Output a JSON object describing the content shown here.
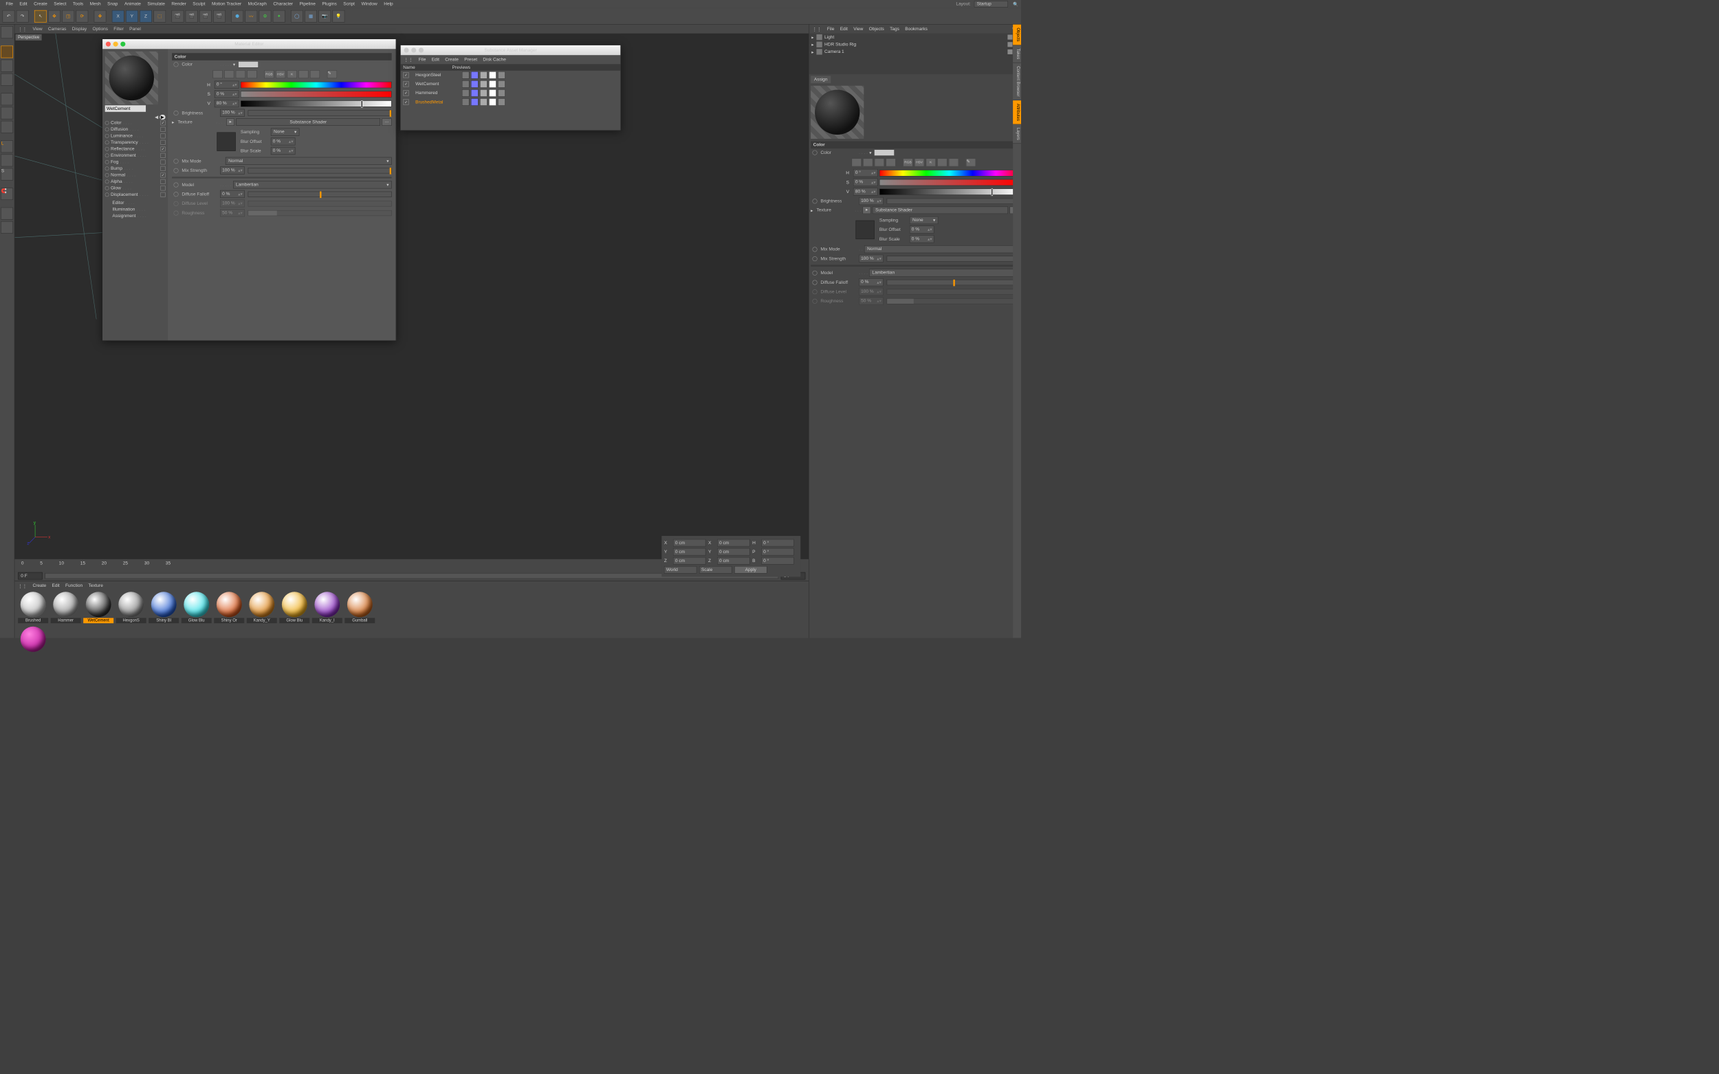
{
  "topmenu": [
    "File",
    "Edit",
    "Create",
    "Select",
    "Tools",
    "Mesh",
    "Snap",
    "Animate",
    "Simulate",
    "Render",
    "Sculpt",
    "Motion Tracker",
    "MoGraph",
    "Character",
    "Pipeline",
    "Plugins",
    "Script",
    "Window",
    "Help"
  ],
  "layout_label": "Layout:",
  "layout_value": "Startup",
  "viewmenu": [
    "View",
    "Cameras",
    "Display",
    "Options",
    "Filter",
    "Panel"
  ],
  "viewport_label": "Perspective",
  "objmenu": [
    "File",
    "Edit",
    "View",
    "Objects",
    "Tags",
    "Bookmarks"
  ],
  "objects": [
    "Light",
    "HDR Studio Rig",
    "Camera 1"
  ],
  "side_tabs": [
    "Objects",
    "Takes",
    "Content Browser",
    "Attributes",
    "Layers"
  ],
  "matmenu": [
    "Create",
    "Edit",
    "Function",
    "Texture"
  ],
  "materials": [
    {
      "name": "Brushed",
      "color": "#bbb"
    },
    {
      "name": "Hammer",
      "color": "#999"
    },
    {
      "name": "WetCement",
      "color": "#333",
      "sel": true
    },
    {
      "name": "HexgonS",
      "color": "#888"
    },
    {
      "name": "Shiny Bl",
      "color": "#2a60d0"
    },
    {
      "name": "Glow Blu",
      "color": "#3be0e8"
    },
    {
      "name": "Shiny Or",
      "color": "#d85a20"
    },
    {
      "name": "Kandy_Y",
      "color": "#e08a20"
    },
    {
      "name": "Glow Blu",
      "color": "#f0b020"
    },
    {
      "name": "Kandy_I",
      "color": "#8a30c0"
    },
    {
      "name": "Gumball",
      "color": "#d06a20"
    }
  ],
  "mat_extra": {
    "name": "",
    "color": "#ff30d0"
  },
  "frame": {
    "a": "0 F",
    "b": "0 F"
  },
  "ticks": [
    "0",
    "5",
    "10",
    "15",
    "20",
    "25",
    "30",
    "35"
  ],
  "coord": {
    "rows": [
      [
        "X",
        "0 cm",
        "X",
        "0 cm",
        "H",
        "0 °"
      ],
      [
        "Y",
        "0 cm",
        "Y",
        "0 cm",
        "P",
        "0 °"
      ],
      [
        "Z",
        "0 cm",
        "Z",
        "0 cm",
        "B",
        "0 °"
      ]
    ],
    "world": "World",
    "scale": "Scale",
    "apply": "Apply"
  },
  "material_editor": {
    "title": "Material Editor",
    "material_name": "WetCement",
    "channels": [
      {
        "n": "Color",
        "on": true,
        "act": true
      },
      {
        "n": "Diffusion",
        "on": false
      },
      {
        "n": "Luminance",
        "on": false
      },
      {
        "n": "Transparency",
        "on": false
      },
      {
        "n": "Reflectance",
        "on": true
      },
      {
        "n": "Environment",
        "on": false
      },
      {
        "n": "Fog",
        "on": false
      },
      {
        "n": "Bump",
        "on": false
      },
      {
        "n": "Normal",
        "on": true
      },
      {
        "n": "Alpha",
        "on": false
      },
      {
        "n": "Glow",
        "on": false
      },
      {
        "n": "Displacement",
        "on": false
      }
    ],
    "extras": [
      "Editor",
      "Illumination",
      "Assignment"
    ],
    "section_color": "Color",
    "color_label": "Color",
    "h_label": "H",
    "h_val": "0 °",
    "s_label": "S",
    "s_val": "0 %",
    "v_label": "V",
    "v_val": "80 %",
    "brightness_label": "Brightness",
    "brightness_val": "100 %",
    "texture_label": "Texture",
    "texture_btn": "Substance Shader",
    "sampling_label": "Sampling",
    "sampling_val": "None",
    "bluroffset_label": "Blur Offset",
    "bluroffset_val": "0 %",
    "blurscale_label": "Blur Scale",
    "blurscale_val": "0 %",
    "mixmode_label": "Mix Mode",
    "mixmode_val": "Normal",
    "mixstrength_label": "Mix Strength",
    "mixstrength_val": "100 %",
    "model_label": "Model",
    "model_val": "Lambertian",
    "falloff_label": "Diffuse Falloff",
    "falloff_val": "0 %",
    "diffuselevel_label": "Diffuse Level",
    "diffuselevel_val": "100 %",
    "roughness_label": "Roughness",
    "roughness_val": "50 %"
  },
  "sam": {
    "title": "Substance Asset Manager",
    "menu": [
      "File",
      "Edit",
      "Create",
      "Preset",
      "Disk Cache"
    ],
    "hdr_name": "Name",
    "hdr_prev": "Previews",
    "assets": [
      {
        "n": "HexgonSteel"
      },
      {
        "n": "WetCement"
      },
      {
        "n": "Hammered"
      },
      {
        "n": "BrushedMetal",
        "sel": true
      }
    ]
  },
  "attr": {
    "assign": "Assign",
    "section_color": "Color",
    "color_label": "Color",
    "h_label": "H",
    "h_val": "0 °",
    "s_label": "S",
    "s_val": "0 %",
    "v_label": "V",
    "v_val": "80 %",
    "brightness_label": "Brightness",
    "brightness_val": "100 %",
    "texture_label": "Texture",
    "texture_btn": "Substance Shader",
    "sampling_label": "Sampling",
    "sampling_val": "None",
    "bluroffset_label": "Blur Offset",
    "bluroffset_val": "0 %",
    "blurscale_label": "Blur Scale",
    "blurscale_val": "0 %",
    "mixmode_label": "Mix Mode",
    "mixmode_val": "Normal",
    "mixstrength_label": "Mix Strength",
    "mixstrength_val": "100 %",
    "model_label": "Model",
    "model_val": "Lambertian",
    "falloff_label": "Diffuse Falloff",
    "falloff_val": "0 %",
    "diffuselevel_label": "Diffuse Level",
    "diffuselevel_val": "100 %",
    "roughness_label": "Roughness",
    "roughness_val": "50 %"
  }
}
